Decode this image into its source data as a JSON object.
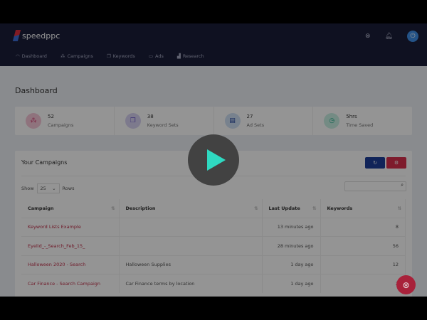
{
  "brand": "speedppc",
  "nav": [
    {
      "label": "Dashboard",
      "icon": "gauge-icon"
    },
    {
      "label": "Campaigns",
      "icon": "sitemap-icon"
    },
    {
      "label": "Keywords",
      "icon": "copy-icon"
    },
    {
      "label": "Ads",
      "icon": "window-icon"
    },
    {
      "label": "Research",
      "icon": "bar-chart-icon"
    }
  ],
  "page_title": "Dashboard",
  "stats": [
    {
      "value": "52",
      "label": "Campaigns",
      "color": "#f6c6d8"
    },
    {
      "value": "38",
      "label": "Keyword Sets",
      "color": "#d8d2f3"
    },
    {
      "value": "27",
      "label": "Ad Sets",
      "color": "#cfe0f5"
    },
    {
      "value": "5hrs",
      "label": "Time Saved",
      "color": "#c9efe4"
    }
  ],
  "campaigns": {
    "title": "Your Campaigns",
    "show_label": "Show",
    "rows_value": "25",
    "rows_label": "Rows",
    "search_value": "",
    "columns": [
      "Campaign",
      "Description",
      "Last Update",
      "Keywords"
    ],
    "rows": [
      [
        "Keyword Lists Example",
        "",
        "13 minutes ago",
        "8"
      ],
      [
        "Eyelid_-_Search_Feb_15_",
        "",
        "28 minutes ago",
        "56"
      ],
      [
        "Halloween 2020 - Search",
        "Halloween Supplies",
        "1 day ago",
        "12"
      ],
      [
        "Car Finance - Search Campaign",
        "Car Finance terms by location",
        "1 day ago",
        "2"
      ]
    ]
  },
  "colors": {
    "refresh_button": "#1e3f9a",
    "delete_button": "#d9304d",
    "play": "#2fd9c1"
  }
}
